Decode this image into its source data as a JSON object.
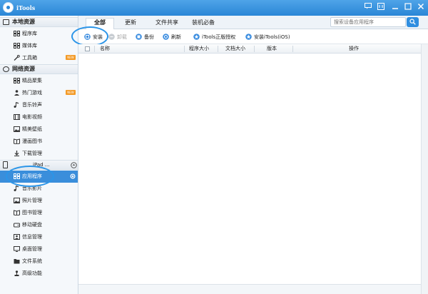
{
  "app": {
    "title": "iTools"
  },
  "window_controls": [
    "message-icon",
    "settings-icon",
    "minimize-icon",
    "maximize-icon",
    "close-icon"
  ],
  "tabs": [
    {
      "label": "全部",
      "active": true
    },
    {
      "label": "更新",
      "active": false
    },
    {
      "label": "文件共享",
      "active": false
    },
    {
      "label": "装机必备",
      "active": false
    }
  ],
  "search": {
    "placeholder": "搜索设备应用程序"
  },
  "toolbar": {
    "install": "安装",
    "uninstall": "卸载",
    "backup": "备份",
    "refresh": "刷新",
    "itools_auth": "iTools正版授权",
    "install_itools": "安装iTools(iOS)"
  },
  "table": {
    "columns": [
      "名称",
      "程序大小",
      "文档大小",
      "版本",
      "操作"
    ]
  },
  "sidebar": {
    "local": {
      "title": "本地资源",
      "items": [
        {
          "label": "程序库",
          "icon": "grid-icon"
        },
        {
          "label": "媒体库",
          "icon": "grid-icon"
        },
        {
          "label": "工具箱",
          "icon": "wrench-icon",
          "badge": "NEW"
        }
      ]
    },
    "network": {
      "title": "网络资源",
      "items": [
        {
          "label": "精品聚集",
          "icon": "grid-icon"
        },
        {
          "label": "热门游戏",
          "icon": "person-icon",
          "badge": "NEW"
        },
        {
          "label": "音乐铃声",
          "icon": "music-icon"
        },
        {
          "label": "电影视频",
          "icon": "film-icon"
        },
        {
          "label": "精美壁纸",
          "icon": "image-icon"
        },
        {
          "label": "漫画图书",
          "icon": "book-icon"
        },
        {
          "label": "下载管理",
          "icon": "download-icon"
        }
      ]
    },
    "device": {
      "title": "iPad ...",
      "items": [
        {
          "label": "应用程序",
          "icon": "grid-icon",
          "selected": true
        },
        {
          "label": "音乐影片",
          "icon": "music-icon"
        },
        {
          "label": "照片管理",
          "icon": "image-icon"
        },
        {
          "label": "图书管理",
          "icon": "book-icon"
        },
        {
          "label": "移动硬盘",
          "icon": "drive-icon"
        },
        {
          "label": "信息管理",
          "icon": "contact-icon"
        },
        {
          "label": "桌面管理",
          "icon": "desktop-icon"
        },
        {
          "label": "文件系统",
          "icon": "folder-icon"
        },
        {
          "label": "高级功能",
          "icon": "joystick-icon"
        }
      ]
    }
  },
  "colors": {
    "accent": "#2a86d6",
    "selected": "#3a8edb",
    "badge": "#f39a26",
    "annotation": "#2b95e8"
  }
}
